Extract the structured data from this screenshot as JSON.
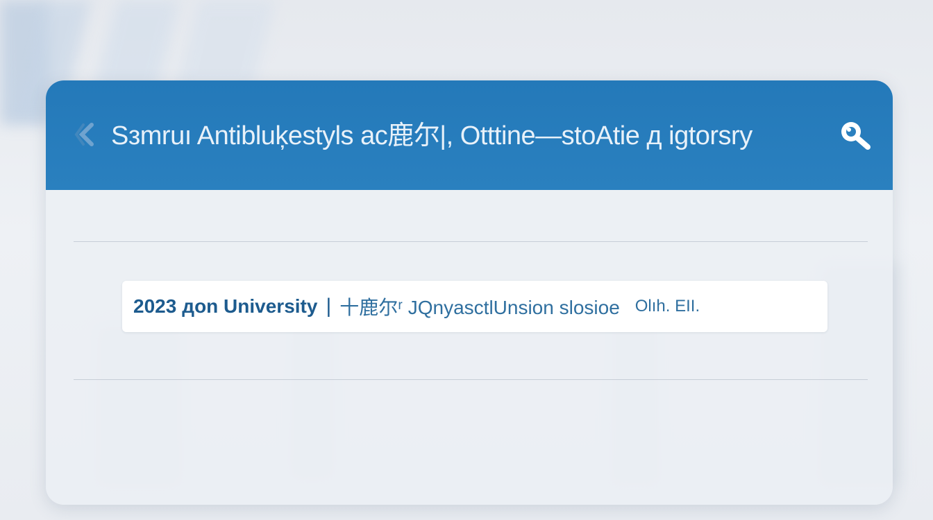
{
  "header": {
    "back_icon": "back-icon",
    "title": "Sзmruı Antibluķestyls ac鹿尔|, Otttine—stoAtie д igtorsry",
    "search_icon": "search-icon"
  },
  "result": {
    "year": "2023",
    "organization": "дon University",
    "separator": "|",
    "description": "十鹿尔ʳ JQnyasctlUnsion slosioe",
    "tail": "Olıh. EII."
  },
  "colors": {
    "header_blue": "#2479b9",
    "title_text": "#e8f1f9",
    "result_text": "#1d5b8e",
    "card_bg": "#ffffff"
  }
}
